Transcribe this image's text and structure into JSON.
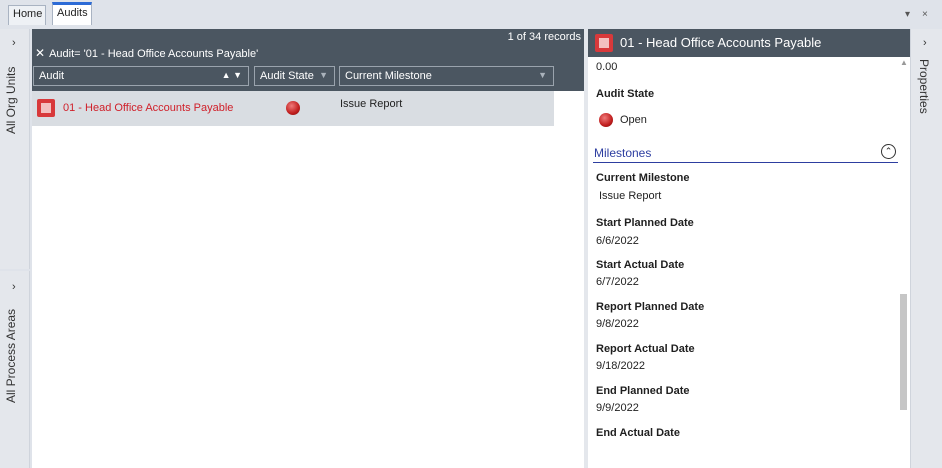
{
  "tabs": [
    {
      "label": "Home"
    },
    {
      "label": "Audits"
    }
  ],
  "window_controls": {
    "dropdown": "▾",
    "close": "×"
  },
  "left_rails": [
    {
      "label": "All Org Units",
      "chevron": "›"
    },
    {
      "label": "All Process Areas",
      "chevron": "›"
    }
  ],
  "grid": {
    "filter_text": "Audit= '01 - Head Office Accounts Payable'",
    "filter_clear": "✕",
    "records": "1 of 34 records",
    "columns": [
      {
        "label": "Audit",
        "sort": "▲ ▼"
      },
      {
        "label": "Audit State",
        "filter": "▼"
      },
      {
        "label": "Current Milestone",
        "filter": "▼"
      }
    ],
    "rows": [
      {
        "audit": "01 - Head Office Accounts Payable",
        "state_icon": "open-state-icon",
        "milestone": "Issue Report"
      }
    ]
  },
  "properties": {
    "title": "01 - Head Office Accounts Payable",
    "top_value": "0.00",
    "audit_state_label": "Audit State",
    "audit_state_value": "Open",
    "section": "Milestones",
    "section_toggle": "⌃",
    "fields": [
      {
        "label": "Current Milestone",
        "value": "Issue Report"
      },
      {
        "label": "Start Planned Date",
        "value": "6/6/2022"
      },
      {
        "label": "Start Actual Date",
        "value": "6/7/2022"
      },
      {
        "label": "Report Planned Date",
        "value": "9/8/2022"
      },
      {
        "label": "Report Actual Date",
        "value": "9/18/2022"
      },
      {
        "label": "End Planned Date",
        "value": "9/9/2022"
      },
      {
        "label": "End Actual Date",
        "value": ""
      }
    ]
  },
  "right_rail": {
    "label": "Properties",
    "chevron": "›"
  },
  "colors": {
    "header_bg": "#4b5661",
    "accent_blue": "#2d6bd6",
    "audit_link_red": "#d0202a",
    "section_blue": "#2d3ea0"
  }
}
